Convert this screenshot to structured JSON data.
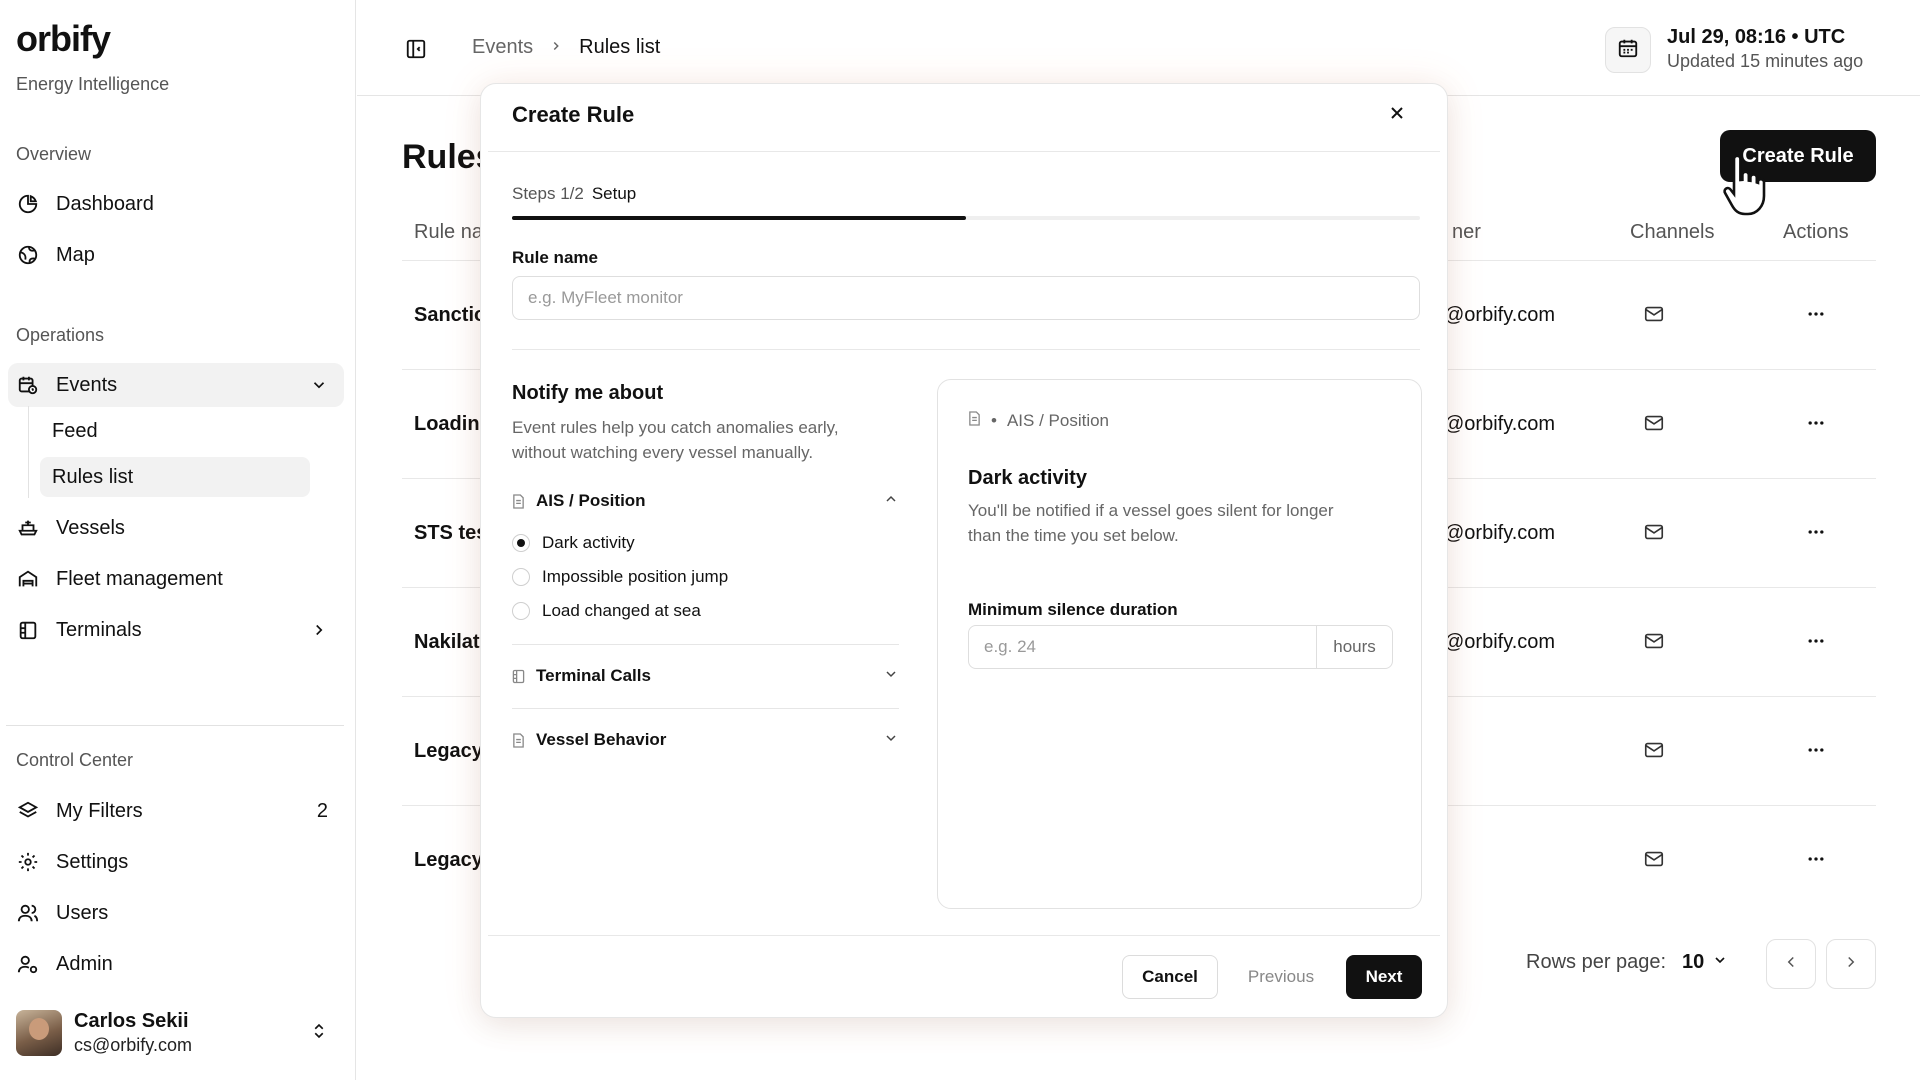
{
  "app": {
    "logo": "orbify",
    "tagline": "Energy Intelligence"
  },
  "sidebar": {
    "overview_label": "Overview",
    "overview": [
      {
        "label": "Dashboard",
        "icon": "pie-chart-icon"
      },
      {
        "label": "Map",
        "icon": "globe-icon"
      }
    ],
    "operations_label": "Operations",
    "events": {
      "label": "Events",
      "icon": "calendar-clock-icon",
      "expanded": true,
      "children": [
        {
          "label": "Feed"
        },
        {
          "label": "Rules list",
          "active": true
        }
      ]
    },
    "operations": [
      {
        "label": "Vessels",
        "icon": "ship-icon"
      },
      {
        "label": "Fleet management",
        "icon": "fleet-icon"
      },
      {
        "label": "Terminals",
        "icon": "terminal-icon"
      }
    ],
    "control_label": "Control Center",
    "control": [
      {
        "label": "My Filters",
        "icon": "layers-icon",
        "count": "2"
      },
      {
        "label": "Settings",
        "icon": "gear-icon"
      },
      {
        "label": "Users",
        "icon": "users-icon"
      },
      {
        "label": "Admin",
        "icon": "admin-icon"
      }
    ],
    "user": {
      "name": "Carlos Sekii",
      "email": "cs@orbify.com"
    }
  },
  "header": {
    "breadcrumb": [
      "Events",
      "Rules list"
    ],
    "time": "Jul 29, 08:16 • UTC",
    "updated": "Updated 15 minutes ago"
  },
  "page": {
    "title": "Rules",
    "create_button": "Create Rule",
    "columns": {
      "name": "Rule na",
      "owner": "ner",
      "channels": "Channels",
      "actions": "Actions"
    },
    "rows": [
      {
        "name": "Sanctio",
        "owner": "@orbify.com"
      },
      {
        "name": "Loadin",
        "owner": "@orbify.com"
      },
      {
        "name": "STS tes",
        "owner": "@orbify.com"
      },
      {
        "name": "Nakilat",
        "owner": "@orbify.com"
      },
      {
        "name": "Legacy",
        "owner": ""
      },
      {
        "name": "Legacy",
        "owner": ""
      }
    ],
    "rows_per_page_label": "Rows per page:",
    "rows_per_page": "10"
  },
  "modal": {
    "title": "Create Rule",
    "steps_label": "Steps 1/2",
    "step_name": "Setup",
    "progress": 0.5,
    "rule_name_label": "Rule name",
    "rule_name_placeholder": "e.g. MyFleet monitor",
    "notify_title": "Notify me about",
    "notify_desc": "Event rules help you catch anomalies early, without watching every vessel manually.",
    "groups": [
      {
        "label": "AIS / Position",
        "expanded": true,
        "options": [
          {
            "label": "Dark activity",
            "selected": true
          },
          {
            "label": "Impossible position jump",
            "selected": false
          },
          {
            "label": "Load changed at sea",
            "selected": false
          }
        ]
      },
      {
        "label": "Terminal Calls",
        "expanded": false
      },
      {
        "label": "Vessel Behavior",
        "expanded": false
      }
    ],
    "detail": {
      "crumb": "AIS / Position",
      "title": "Dark activity",
      "desc": "You'll be notified if a vessel goes silent for longer than the time you set below.",
      "field_label": "Minimum silence duration",
      "field_placeholder": "e.g. 24",
      "unit": "hours"
    },
    "buttons": {
      "cancel": "Cancel",
      "previous": "Previous",
      "next": "Next"
    }
  }
}
